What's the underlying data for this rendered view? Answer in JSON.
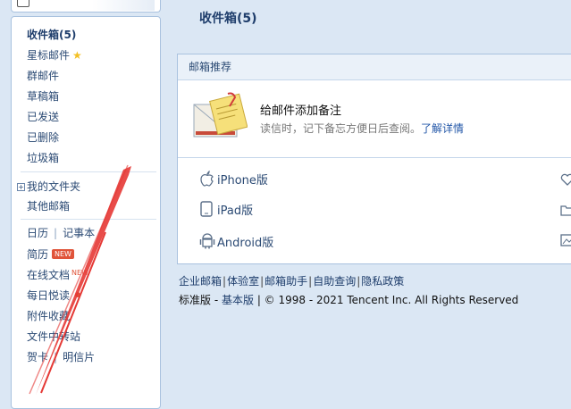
{
  "sidebar": {
    "inbox": "收件箱(5)",
    "starred": "星标邮件",
    "group_mail": "群邮件",
    "drafts": "草稿箱",
    "sent": "已发送",
    "deleted": "已删除",
    "spam": "垃圾箱",
    "my_folders": "我的文件夹",
    "other_mailboxes": "其他邮箱",
    "calendar": "日历",
    "notepad": "记事本",
    "resume": "简历",
    "online_docs": "在线文档",
    "daily_digest": "每日悦读",
    "attachment_favorites": "附件收藏",
    "file_transfer": "文件中转站",
    "greeting_card": "贺卡",
    "postcard": "明信片",
    "new_badge": "NEW"
  },
  "main": {
    "title": "收件箱(5)",
    "recommend_header": "邮箱推荐",
    "feature_title": "给邮件添加备注",
    "feature_desc": "读信时，记下备忘方便日后查阅。",
    "feature_link": "了解详情",
    "apps": [
      "iPhone版",
      "iPad版",
      "Android版"
    ]
  },
  "footer": {
    "links": [
      "企业邮箱",
      "体验室",
      "邮箱助手",
      "自助查询",
      "隐私政策"
    ],
    "standard": "标准版",
    "basic": "基本版",
    "copyright": "© 1998 - 2021 Tencent Inc. All Rights Reserved"
  },
  "colors": {
    "accent": "#2357a8",
    "badge": "#e0543a",
    "arrow": "#e53935"
  }
}
